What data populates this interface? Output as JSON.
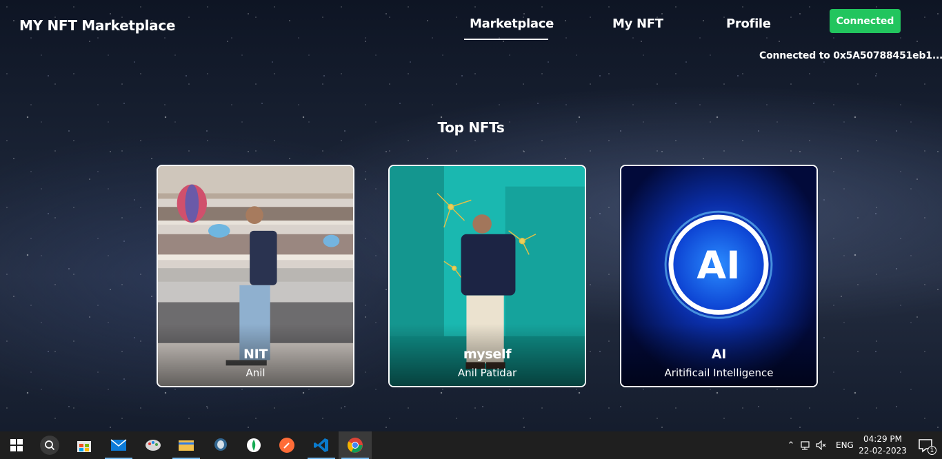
{
  "header": {
    "brand": "MY NFT Marketplace",
    "nav": [
      "Marketplace",
      "My NFT",
      "Profile"
    ],
    "connect_label": "Connected",
    "connected_to": "Connected to 0x5A50788451eb1...",
    "colors": {
      "connect_button": "#22c55e"
    }
  },
  "main": {
    "section_title": "Top NFTs",
    "cards": [
      {
        "name": "NIT",
        "description": "Anil"
      },
      {
        "name": "myself",
        "description": "Anil Patidar"
      },
      {
        "name": "AI",
        "description": "Aritificail Intelligence",
        "image_text": "AI"
      }
    ]
  },
  "taskbar": {
    "icons": [
      "windows-start-icon",
      "search-icon",
      "store-icon",
      "mail-icon",
      "paint-icon",
      "file-explorer-icon",
      "postgres-icon",
      "mongodb-icon",
      "postman-icon",
      "vscode-icon",
      "chrome-icon"
    ],
    "language": "ENG",
    "time": "04:29 PM",
    "date": "22-02-2023",
    "notification_count": "1"
  }
}
